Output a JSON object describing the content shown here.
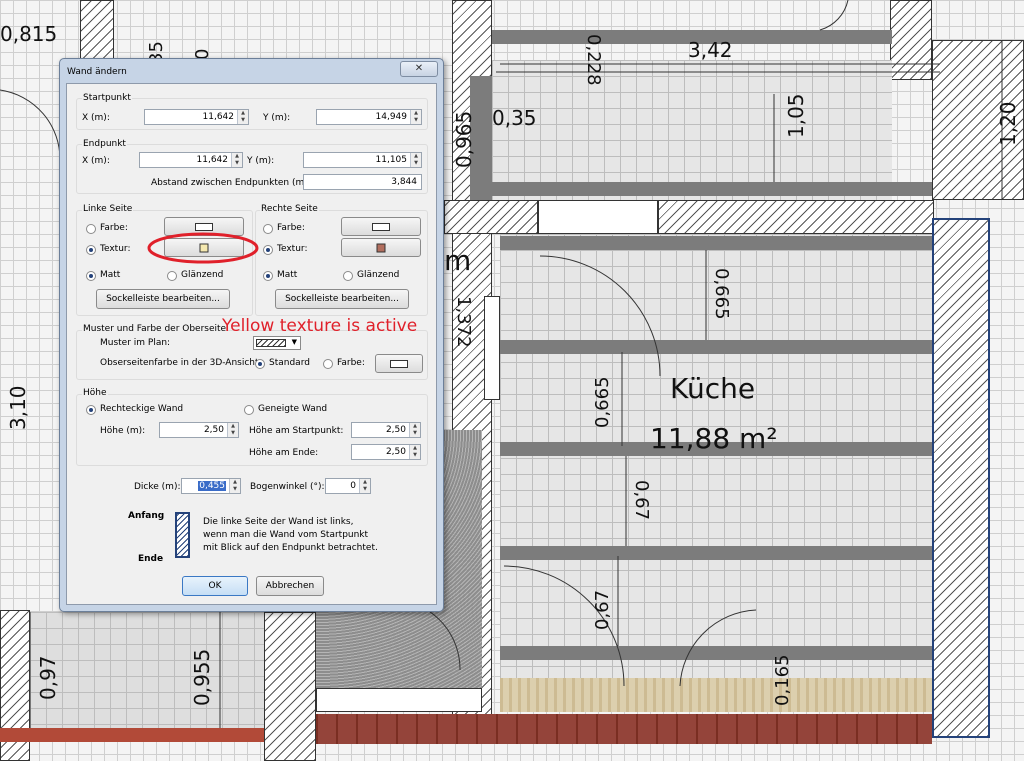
{
  "plan": {
    "dims": {
      "d0815": "0,815",
      "d35": "35",
      "d0": "0",
      "d0228": "0,228",
      "d342": "3,42",
      "d120": "1,20",
      "d035": "0,35",
      "d0965": "0,965",
      "d105": "1,05",
      "d0665a": "0,665",
      "d1372": "1,372",
      "d0665b": "0,665",
      "d067a": "0,67",
      "d067b": "0,67",
      "d0165": "0,165",
      "d310": "3,10",
      "d097": "0,97",
      "d0955": "0,955"
    },
    "room_name": "Küche",
    "room_area": "11,88 m²",
    "room_partial": "m"
  },
  "annotation": {
    "note": "Yellow texture is active",
    "color": "#e0202a"
  },
  "dialog": {
    "title": "Wand ändern",
    "close": "✕",
    "start": {
      "title": "Startpunkt",
      "x_label": "X (m):",
      "x_value": "11,642",
      "y_label": "Y (m):",
      "y_value": "14,949"
    },
    "end": {
      "title": "Endpunkt",
      "x_label": "X (m):",
      "x_value": "11,642",
      "y_label": "Y (m):",
      "y_value": "11,105",
      "distance_label": "Abstand zwischen Endpunkten (m):",
      "distance_value": "3,844"
    },
    "left_side": {
      "title": "Linke Seite",
      "color_label": "Farbe:",
      "texture_label": "Textur:",
      "matte_label": "Matt",
      "glossy_label": "Glänzend",
      "baseboard_button": "Sockelleiste bearbeiten...",
      "texture_color": "#f5e9b0"
    },
    "right_side": {
      "title": "Rechte Seite",
      "color_label": "Farbe:",
      "texture_label": "Textur:",
      "matte_label": "Matt",
      "glossy_label": "Glänzend",
      "baseboard_button": "Sockelleiste bearbeiten...",
      "texture_color": "#b26e5e"
    },
    "top": {
      "title": "Muster und Farbe der Oberseite",
      "pattern_label": "Muster im Plan:",
      "color3d_label": "Obserseitenfarbe in der 3D-Ansicht:",
      "standard_label": "Standard",
      "color_label": "Farbe:"
    },
    "height": {
      "title": "Höhe",
      "rect_label": "Rechteckige Wand",
      "sloped_label": "Geneigte Wand",
      "height_label": "Höhe (m):",
      "height_value": "2,50",
      "start_label": "Höhe am Startpunkt:",
      "start_value": "2,50",
      "end_label": "Höhe am Ende:",
      "end_value": "2,50"
    },
    "thickness_label": "Dicke (m):",
    "thickness_value": "0,455",
    "arc_label": "Bogenwinkel (°):",
    "arc_value": "0",
    "start_word": "Anfang",
    "end_word": "Ende",
    "info_line1": "Die linke Seite der Wand ist links,",
    "info_line2": "wenn man die Wand vom Startpunkt",
    "info_line3": "mit Blick auf den Endpunkt betrachtet.",
    "ok": "OK",
    "cancel": "Abbrechen"
  }
}
